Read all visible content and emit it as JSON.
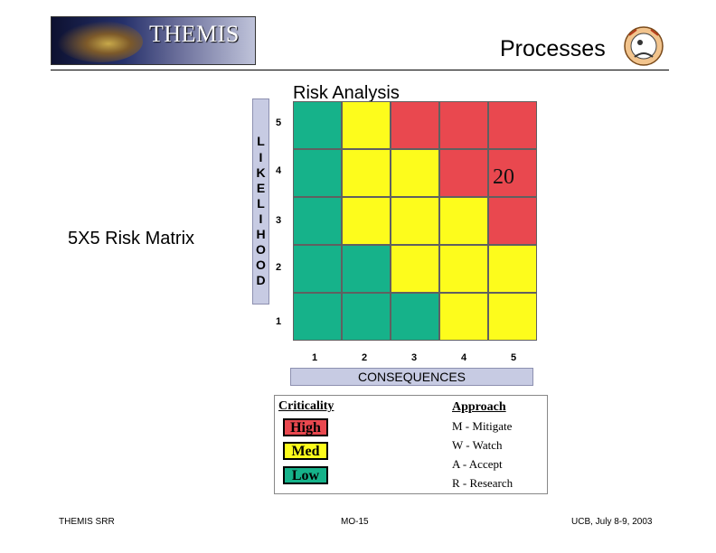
{
  "header": {
    "logo_text": "THEMIS",
    "title": "Processes"
  },
  "subtitle": "Risk Analysis",
  "left_label": "5X5 Risk Matrix",
  "matrix": {
    "likelihood_letters": [
      "L",
      "I",
      "K",
      "E",
      "L",
      "I",
      "H",
      "O",
      "O",
      "D"
    ],
    "likelihood_levels": [
      "5",
      "4",
      "3",
      "2",
      "1"
    ],
    "consequence_levels": [
      "1",
      "2",
      "3",
      "4",
      "5"
    ],
    "consequence_label": "CONSEQUENCES",
    "rows": [
      [
        "green",
        "yellow",
        "red",
        "red",
        "red"
      ],
      [
        "green",
        "yellow",
        "yellow",
        "red",
        "red"
      ],
      [
        "green",
        "yellow",
        "yellow",
        "yellow",
        "red"
      ],
      [
        "green",
        "green",
        "yellow",
        "yellow",
        "yellow"
      ],
      [
        "green",
        "green",
        "green",
        "yellow",
        "yellow"
      ]
    ],
    "colors": {
      "green": "#16b28a",
      "yellow": "#fdfc1c",
      "red": "#e9484f"
    },
    "score_text": "20"
  },
  "legend": {
    "criticality_title": "Criticality",
    "approach_title": "Approach",
    "criticality": [
      {
        "label": "High",
        "color": "#e9484f"
      },
      {
        "label": "Med",
        "color": "#fdfc1c"
      },
      {
        "label": "Low",
        "color": "#16b28a"
      }
    ],
    "approach": [
      "M - Mitigate",
      "W - Watch",
      "A - Accept",
      "R - Research"
    ]
  },
  "footer": {
    "left": "THEMIS SRR",
    "center": "MO-15",
    "right": "UCB, July 8-9, 2003"
  }
}
